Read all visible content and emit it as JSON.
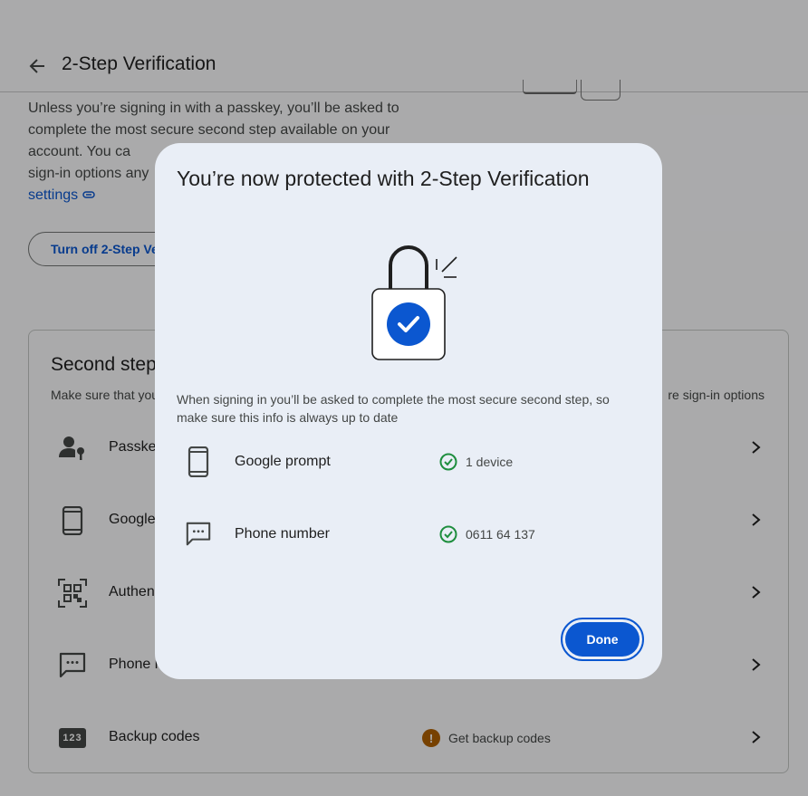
{
  "header": {
    "title": "2-Step Verification",
    "back_icon": "arrow-back-icon"
  },
  "intro": {
    "text": "Unless you’re signing in with a passkey, you’ll be asked to complete the most secure second step available on your account. You ca",
    "text_line4": "sign-in options any",
    "link": "settings"
  },
  "turn_off_button": {
    "label": "Turn off 2-Step Ve"
  },
  "second_steps": {
    "title": "Second step",
    "subtitle": "Make sure that you",
    "subtitle_right": "re sign-in options",
    "rows": [
      {
        "label": "Passke",
        "icon": "passkey-person-icon"
      },
      {
        "label": "Google",
        "icon": "phone-icon"
      },
      {
        "label": "Authen",
        "icon": "qr-code-icon"
      },
      {
        "label": "Phone n",
        "icon": "message-icon"
      },
      {
        "label": "Backup codes",
        "icon": "backup-codes-123-icon",
        "icon_text": "123",
        "status": "Get backup codes",
        "status_icon": "warning-icon",
        "status_symbol": "!"
      }
    ]
  },
  "dialog": {
    "title": "You’re now protected with 2-Step Verification",
    "description": "When signing in you’ll be asked to complete the most secure second step, so make sure this info is always up to date",
    "items": [
      {
        "label": "Google prompt",
        "status": "1 device",
        "icon": "phone-icon",
        "status_icon": "check-circle-icon"
      },
      {
        "label": "Phone number",
        "status": "0611 64 137",
        "icon": "message-icon",
        "status_icon": "check-circle-icon"
      }
    ],
    "done_label": "Done"
  },
  "colors": {
    "accent": "#0b57d0",
    "success": "#1e8e3e",
    "warning": "#b06000",
    "dialog_bg": "#e9eef6"
  }
}
